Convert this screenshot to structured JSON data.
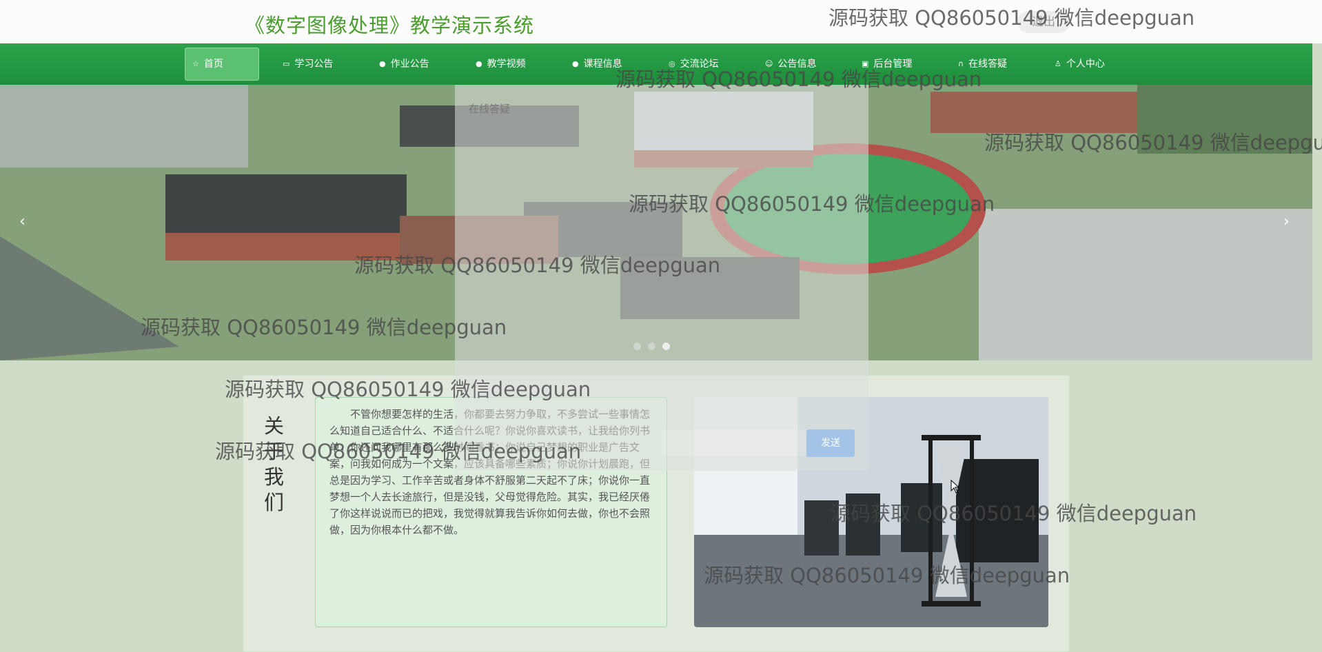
{
  "header": {
    "title": "《数字图像处理》教学演示系统",
    "logout_label": "退出"
  },
  "nav": {
    "items": [
      {
        "label": "首页",
        "icon": "star-icon"
      },
      {
        "label": "学习公告",
        "icon": "bag-icon"
      },
      {
        "label": "作业公告",
        "icon": "info-icon"
      },
      {
        "label": "教学视频",
        "icon": "question-icon"
      },
      {
        "label": "课程信息",
        "icon": "info-icon"
      },
      {
        "label": "交流论坛",
        "icon": "chat-icon"
      },
      {
        "label": "公告信息",
        "icon": "smile-icon"
      },
      {
        "label": "后台管理",
        "icon": "clipboard-icon"
      },
      {
        "label": "在线答疑",
        "icon": "headset-icon"
      },
      {
        "label": "个人中心",
        "icon": "user-icon"
      }
    ],
    "active_index": 0
  },
  "banner": {
    "prev_label": "‹",
    "next_label": "›",
    "slides_count": 3,
    "active_slide": 2
  },
  "chat_overlay": {
    "title": "在线答疑",
    "send_label": "发送"
  },
  "about": {
    "heading": "关于我们",
    "text": "不管你想要怎样的生活，你都要去努力争取，不多尝试一些事情怎么知道自己适合什么、不适合什么呢？你说你喜欢读书，让我给你列书单，你还问我哪里有那么多时间看书；你说自己梦想的职业是广告文案，问我如何成为一个文案，应该具备哪些素质；你说你计划晨跑，但总是因为学习、工作辛苦或者身体不舒服第二天起不了床；你说你一直梦想一个人去长途旅行，但是没钱，父母觉得危险。其实，我已经厌倦了你这样说说而已的把戏，我觉得就算我告诉你如何去做，你也不会照做，因为你根本什么都不做。"
  },
  "watermark": {
    "text": "源码获取 QQ86050149 微信deepguan"
  },
  "colors": {
    "brand_green": "#1f8f3c",
    "title_green": "#4b9d2e"
  }
}
